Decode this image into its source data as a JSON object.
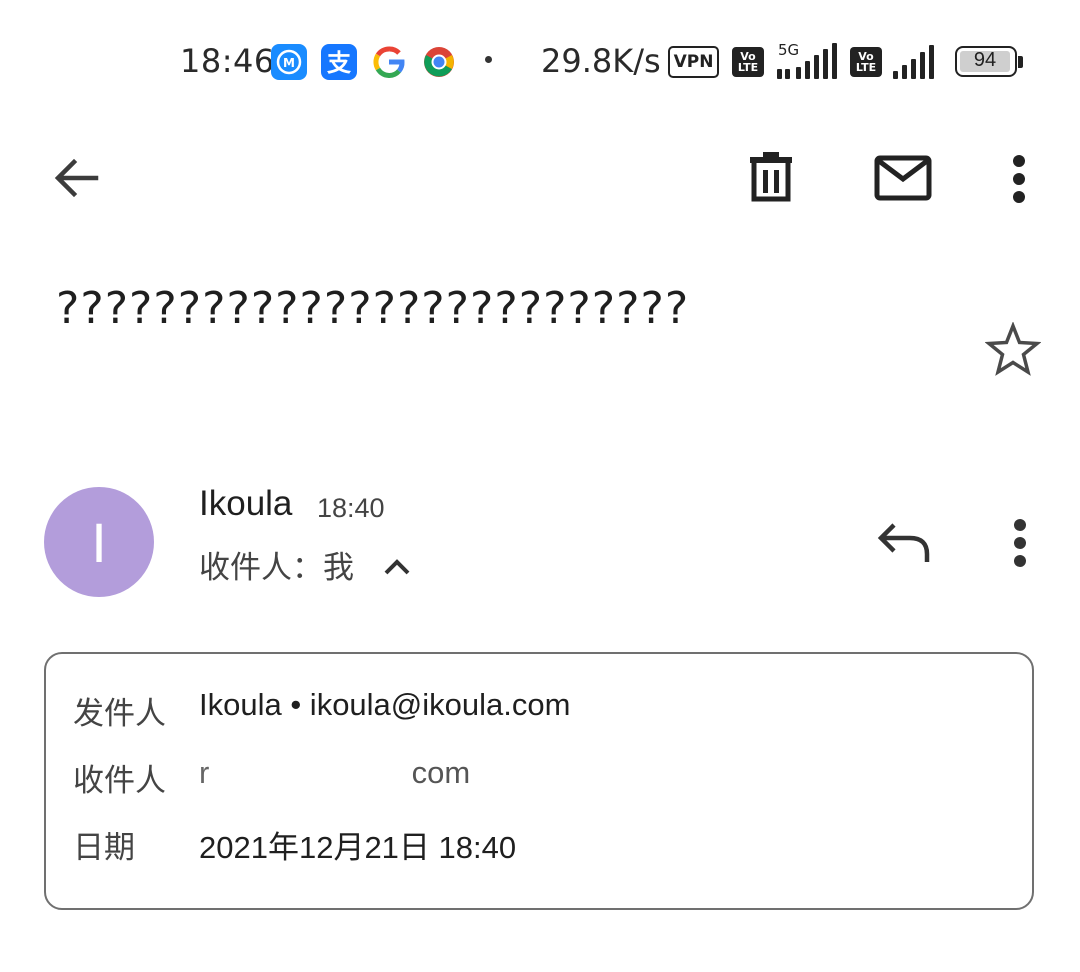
{
  "status_bar": {
    "time": "18:46",
    "speed": "29.8K/s",
    "vpn_label": "VPN",
    "volte_top": "Vo",
    "volte_bottom": "LTE",
    "network_type": "5G",
    "battery_level": "94",
    "app_icons": [
      "meituan-icon",
      "alipay-icon",
      "google-icon",
      "chrome-icon"
    ],
    "colors": {
      "alipay": "#1677ff",
      "meituan_blue": "#1a8cff"
    }
  },
  "toolbar": {
    "icons": [
      "back-arrow-icon",
      "trash-icon",
      "mail-icon",
      "more-vert-icon"
    ]
  },
  "email": {
    "subject": "??????????????????????????",
    "sender_initial": "I",
    "sender_name": "Ikoula",
    "time": "18:40",
    "recipient_prefix": "收件人：",
    "recipient": "我",
    "avatar_color": "#b39ddb"
  },
  "details": {
    "from_label": "发件人",
    "from_value": "Ikoula • ikoula@ikoula.com",
    "to_label": "收件人",
    "to_value_start": "r",
    "to_value_end": "com",
    "date_label": "日期",
    "date_value": "2021年12月21日 18:40"
  }
}
